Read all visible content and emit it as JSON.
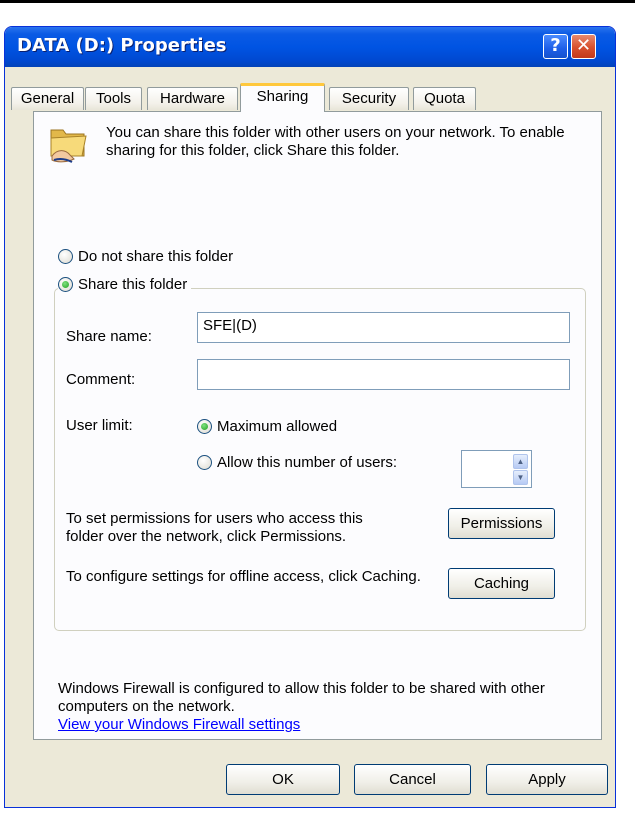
{
  "window": {
    "title": "DATA (D:) Properties",
    "help_glyph": "?",
    "close_glyph": "✕"
  },
  "tabs": [
    "General",
    "Tools",
    "Hardware",
    "Sharing",
    "Security",
    "Quota"
  ],
  "active_tab": "Sharing",
  "sharing": {
    "intro": "You can share this folder with other users on your network.  To enable sharing for this folder, click Share this folder.",
    "do_not_share_label": "Do not share this folder",
    "share_label": "Share this folder",
    "share_name_label": "Share name:",
    "share_name_value": "SFE|(D)",
    "comment_label": "Comment:",
    "comment_value": "",
    "user_limit_label": "User limit:",
    "max_allowed_label": "Maximum allowed",
    "allow_number_label": "Allow this number of users:",
    "user_count_value": "",
    "permissions_text": "To set permissions for users who access this folder over the network, click Permissions.",
    "permissions_button": "Permissions",
    "caching_text": "To configure settings for offline access, click Caching.",
    "caching_button": "Caching",
    "firewall_text": "Windows Firewall is configured to allow this folder to be shared with other computers on the network.",
    "firewall_link": "View your Windows Firewall settings"
  },
  "footer": {
    "ok": "OK",
    "cancel": "Cancel",
    "apply": "Apply"
  }
}
